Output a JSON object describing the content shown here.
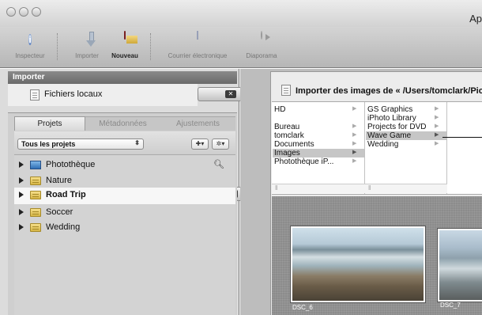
{
  "window": {
    "title": "Ap"
  },
  "toolbar": {
    "inspector": "Inspecteur",
    "import": "Importer",
    "new": "Nouveau",
    "email": "Courrier électronique",
    "slideshow": "Diaporama"
  },
  "importer": {
    "header": "Importer",
    "local_files": "Fichiers locaux",
    "panel_title": "Importer des images de « /Users/tomclark/Pic"
  },
  "tabs": [
    "Projets",
    "Métadonnées",
    "Ajustements"
  ],
  "project_filter": {
    "selected": "Tous les projets"
  },
  "library": [
    {
      "label": "Photothèque",
      "selected": false
    },
    {
      "label": "Nature",
      "selected": false
    },
    {
      "label": "Road Trip",
      "selected": true
    },
    {
      "label": "Soccer",
      "selected": false
    },
    {
      "label": "Wedding",
      "selected": false
    }
  ],
  "browser": {
    "col1": [
      "HD",
      "Bureau",
      "tomclark",
      "Documents",
      "Images",
      "Photothèque iP..."
    ],
    "col2": [
      "GS Graphics",
      "iPhoto Library",
      "Projects for DVD",
      "Wave Game",
      "Wedding"
    ],
    "col1_selected": "Images",
    "col2_selected": "Wave Game"
  },
  "thumbnails": [
    "DSC_6",
    "DSC_7"
  ]
}
